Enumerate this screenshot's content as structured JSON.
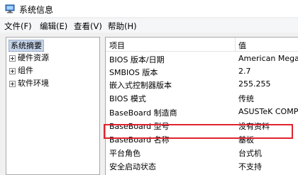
{
  "window": {
    "title": "系统信息",
    "icon": "system-info-icon"
  },
  "menu": [
    "文件(F)",
    "编辑(E)",
    "查看(V)",
    "帮助(H)"
  ],
  "tree": {
    "root": "系统摘要",
    "nodes": [
      "硬件资源",
      "组件",
      "软件环境"
    ]
  },
  "list": {
    "headers": {
      "item": "项目",
      "value": "值"
    },
    "rows": [
      {
        "item": "BIOS 版本/日期",
        "value": "American Mega"
      },
      {
        "item": "SMBIOS 版本",
        "value": "2.7"
      },
      {
        "item": "嵌入式控制器版本",
        "value": "255.255"
      },
      {
        "item": "BIOS 模式",
        "value": "传统"
      },
      {
        "item": "BaseBoard 制造商",
        "value": "ASUSTeK COMP"
      },
      {
        "item": "BaseBoard 型号",
        "value": "没有资料"
      },
      {
        "item": "BaseBoard 名称",
        "value": "基板"
      },
      {
        "item": "平台角色",
        "value": "台式机"
      },
      {
        "item": "安全启动状态",
        "value": "不支持"
      }
    ]
  },
  "highlight_color": "#e0232f"
}
